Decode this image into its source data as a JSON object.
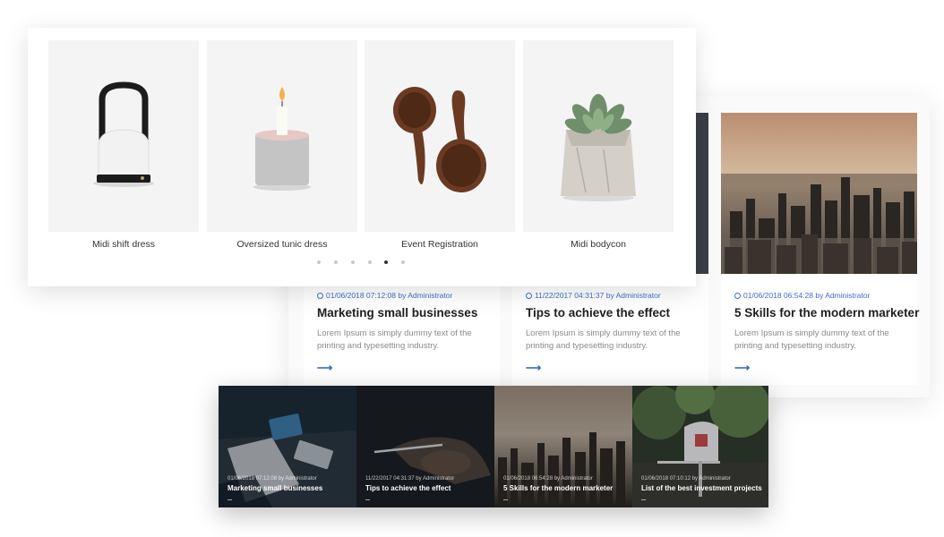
{
  "products": [
    {
      "name": "Midi shift dress",
      "icon": "lantern-lamp-icon"
    },
    {
      "name": "Oversized tunic dress",
      "icon": "candle-icon"
    },
    {
      "name": "Event Registration",
      "icon": "wooden-spoons-icon"
    },
    {
      "name": "Midi bodycon",
      "icon": "succulent-plant-icon"
    }
  ],
  "carousel": {
    "dot_count": 6,
    "active_index": 4
  },
  "blog_posts": [
    {
      "meta": "01/06/2018 07:12:08 by Administrator",
      "title": "Marketing small businesses",
      "excerpt": "Lorem Ipsum is simply dummy text of the printing and typesetting industry.",
      "arrow": "⟶"
    },
    {
      "meta": "11/22/2017 04:31:37 by Administrator",
      "title": "Tips to achieve the effect",
      "excerpt": "Lorem Ipsum is simply dummy text of the printing and typesetting industry.",
      "arrow": "⟶"
    },
    {
      "meta": "01/06/2018 06:54:28 by Administrator",
      "title": "5 Skills for the modern marketer",
      "excerpt": "Lorem Ipsum is simply dummy text of the printing and typesetting industry.",
      "arrow": "⟶"
    }
  ],
  "overlay_posts": [
    {
      "meta": "01/06/2018 07:12:08 by Administrator",
      "title": "Marketing small businesses"
    },
    {
      "meta": "11/22/2017 04:31:37 by Administrator",
      "title": "Tips to achieve the effect"
    },
    {
      "meta": "01/06/2018 06:54:28 by Administrator",
      "title": "5 Skills for the modern marketer"
    },
    {
      "meta": "01/06/2018 07:10:12 by Administrator",
      "title": "List of the best investment projects"
    }
  ],
  "colors": {
    "accent": "#3b6fc9",
    "title": "#1e1e1e",
    "excerpt": "#8a8a8a",
    "card_bg": "#f4f4f4"
  }
}
